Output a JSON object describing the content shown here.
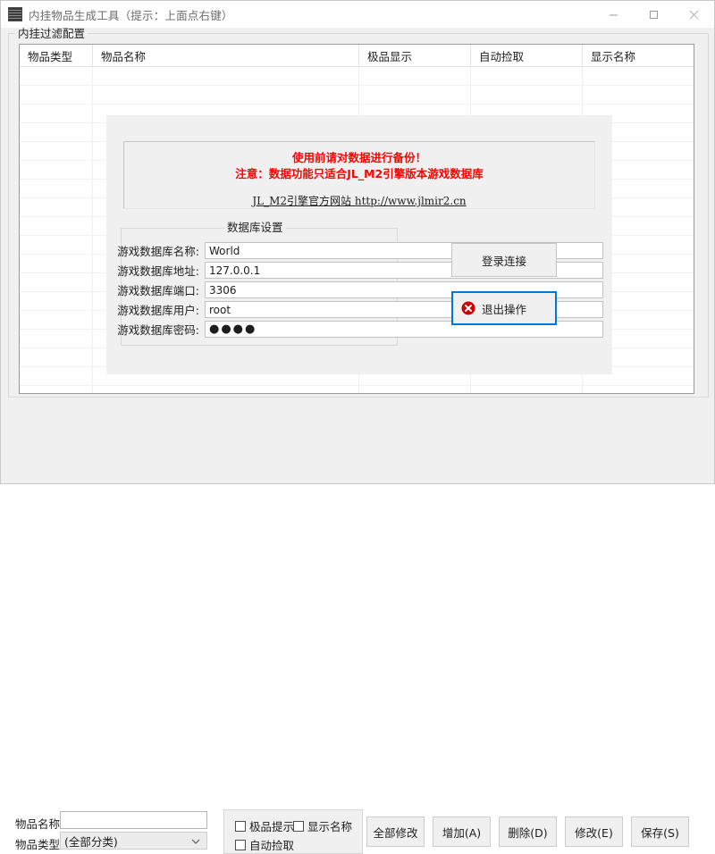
{
  "window": {
    "title": "内挂物品生成工具（提示：上面点右键）",
    "icon": "app-icon",
    "controls": {
      "minimize": "minimize-icon",
      "maximize": "maximize-icon",
      "close": "close-icon"
    }
  },
  "filter_group": {
    "label": "内挂过滤配置",
    "columns": [
      "物品类型",
      "物品名称",
      "极品显示",
      "自动捡取",
      "显示名称"
    ],
    "rows": []
  },
  "notice": {
    "line1": "使用前请对数据进行备份！",
    "line2": "注意：数据功能只适合JL_M2引擎版本游戏数据库",
    "link": "JL_M2引擎官方网站  http://www.jlmir2.cn",
    "color": "#ff0000"
  },
  "db_settings": {
    "label": "数据库设置",
    "fields": [
      {
        "label": "游戏数据库名称:",
        "value": "World"
      },
      {
        "label": "游戏数据库地址:",
        "value": "127.0.0.1"
      },
      {
        "label": "游戏数据库端口:",
        "value": "3306"
      },
      {
        "label": "游戏数据库用户:",
        "value": "root"
      },
      {
        "label": "游戏数据库密码:",
        "value": "●●●●"
      }
    ]
  },
  "connect_buttons": {
    "login": "登录连接",
    "exit": "退出操作",
    "exit_icon": "error-circle-icon",
    "focus_color": "#0078d7"
  },
  "bottom": {
    "name_label": "物品名称:",
    "name_value": "",
    "name_placeholder": "",
    "type_label": "物品类型:",
    "type_value": "(全部分类)",
    "type_options": [
      "(全部分类)"
    ],
    "dropdown_icon": "chevron-down-icon",
    "checkboxes": [
      {
        "label": "极品提示",
        "checked": false
      },
      {
        "label": "显示名称",
        "checked": false
      },
      {
        "label": "自动捡取",
        "checked": false
      }
    ],
    "actions": [
      "全部修改",
      "增加(A)",
      "删除(D)",
      "修改(E)",
      "保存(S)"
    ]
  }
}
